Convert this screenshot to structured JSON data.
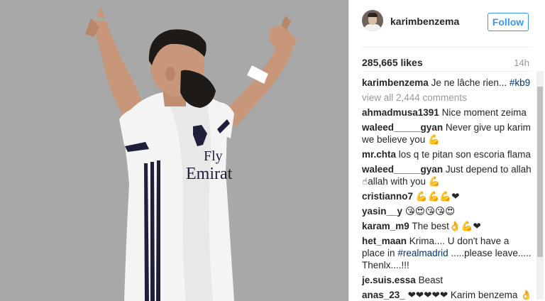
{
  "header": {
    "username": "karimbenzema",
    "follow_label": "Follow"
  },
  "post": {
    "likes": "285,665 likes",
    "age": "14h",
    "caption_user": "karimbenzema",
    "caption_text": "Je ne lâche rien...",
    "caption_tag": "#kb9",
    "view_all": "view all 2,444 comments",
    "jersey_text_1": "Fly",
    "jersey_text_2": "Emirat"
  },
  "comments": [
    {
      "user": "ahmadmusa1391",
      "text": "Nice moment zeima"
    },
    {
      "user": "waleed_____gyan",
      "text": "Never give up karim we believe you 💪"
    },
    {
      "user": "mr.chta",
      "text": "los q te pitan son escoria flama"
    },
    {
      "user": "waleed_____gyan",
      "text": "Just depend to allah ☝allah with you 💪"
    },
    {
      "user": "cristianno7",
      "text": "💪💪💪❤"
    },
    {
      "user": "yasin__y",
      "text": "😘😍😘😘😍"
    },
    {
      "user": "karam_m9",
      "text": "The best👌💪❤"
    },
    {
      "user": "het_maan",
      "text": "Krima.... U don't have a place in",
      "tag": "#realmadrid",
      "text2": ".....please leave..... Thenlx....!!!"
    },
    {
      "user": "je.suis.essa",
      "text": "Beast"
    },
    {
      "user": "anas_23_",
      "text": "❤❤❤❤❤ Karim benzema 👌👌👌 never give up"
    }
  ],
  "colors": {
    "photo_bg": "#a8a8a8",
    "follow": "#3897f0",
    "hashtag": "#003569",
    "muted": "#999999"
  }
}
